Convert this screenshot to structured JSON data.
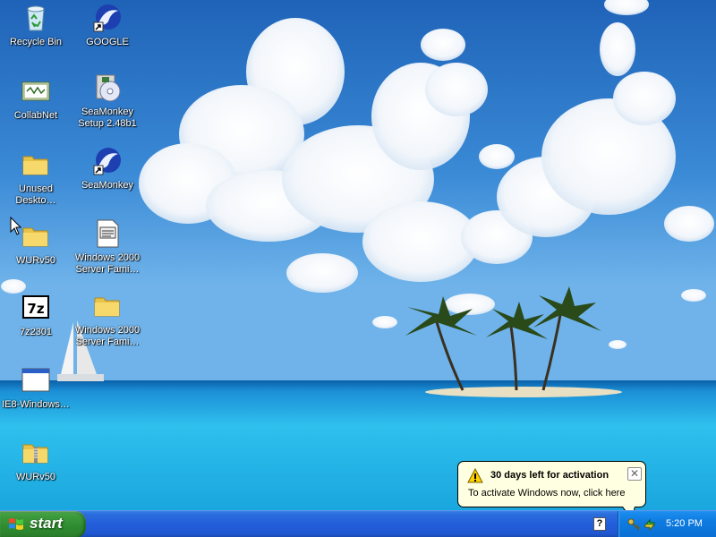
{
  "desktop": {
    "icons": [
      {
        "label": "Recycle Bin",
        "icon": "recycle-bin-icon"
      },
      {
        "label": "GOOGLE",
        "icon": "seamonkey-shortcut-icon"
      },
      {
        "label": "CollabNet",
        "icon": "collabnet-icon"
      },
      {
        "label": "SeaMonkey\nSetup 2.48b1",
        "icon": "installer-cd-icon"
      },
      {
        "label": "Unused\nDeskto…",
        "icon": "folder-icon"
      },
      {
        "label": "SeaMonkey",
        "icon": "seamonkey-shortcut-icon"
      },
      {
        "label": "WURv50",
        "icon": "folder-icon"
      },
      {
        "label": "Windows 2000\nServer Fami…",
        "icon": "text-document-icon"
      },
      {
        "label": "7z2301",
        "icon": "7zip-icon"
      },
      {
        "label": "Windows 2000\nServer Fami…",
        "icon": "folder-icon"
      },
      {
        "label": "IE8-Windows…",
        "icon": "application-window-icon"
      },
      {
        "label": "WURv50",
        "icon": "zip-folder-icon"
      }
    ]
  },
  "balloon": {
    "title": "30 days left for activation",
    "text": "To activate Windows now, click here",
    "close_glyph": "✕",
    "icon": "warning-icon"
  },
  "taskbar": {
    "start_label": "start",
    "help_glyph": "?",
    "clock": "5:20 PM",
    "tray_icons": [
      "activation-keys-icon",
      "network-arrows-icon"
    ]
  },
  "colors": {
    "taskbar": "#245edb",
    "start_button": "#3c9a3c",
    "tray": "#0e7be0",
    "balloon_bg": "#ffffe1"
  }
}
